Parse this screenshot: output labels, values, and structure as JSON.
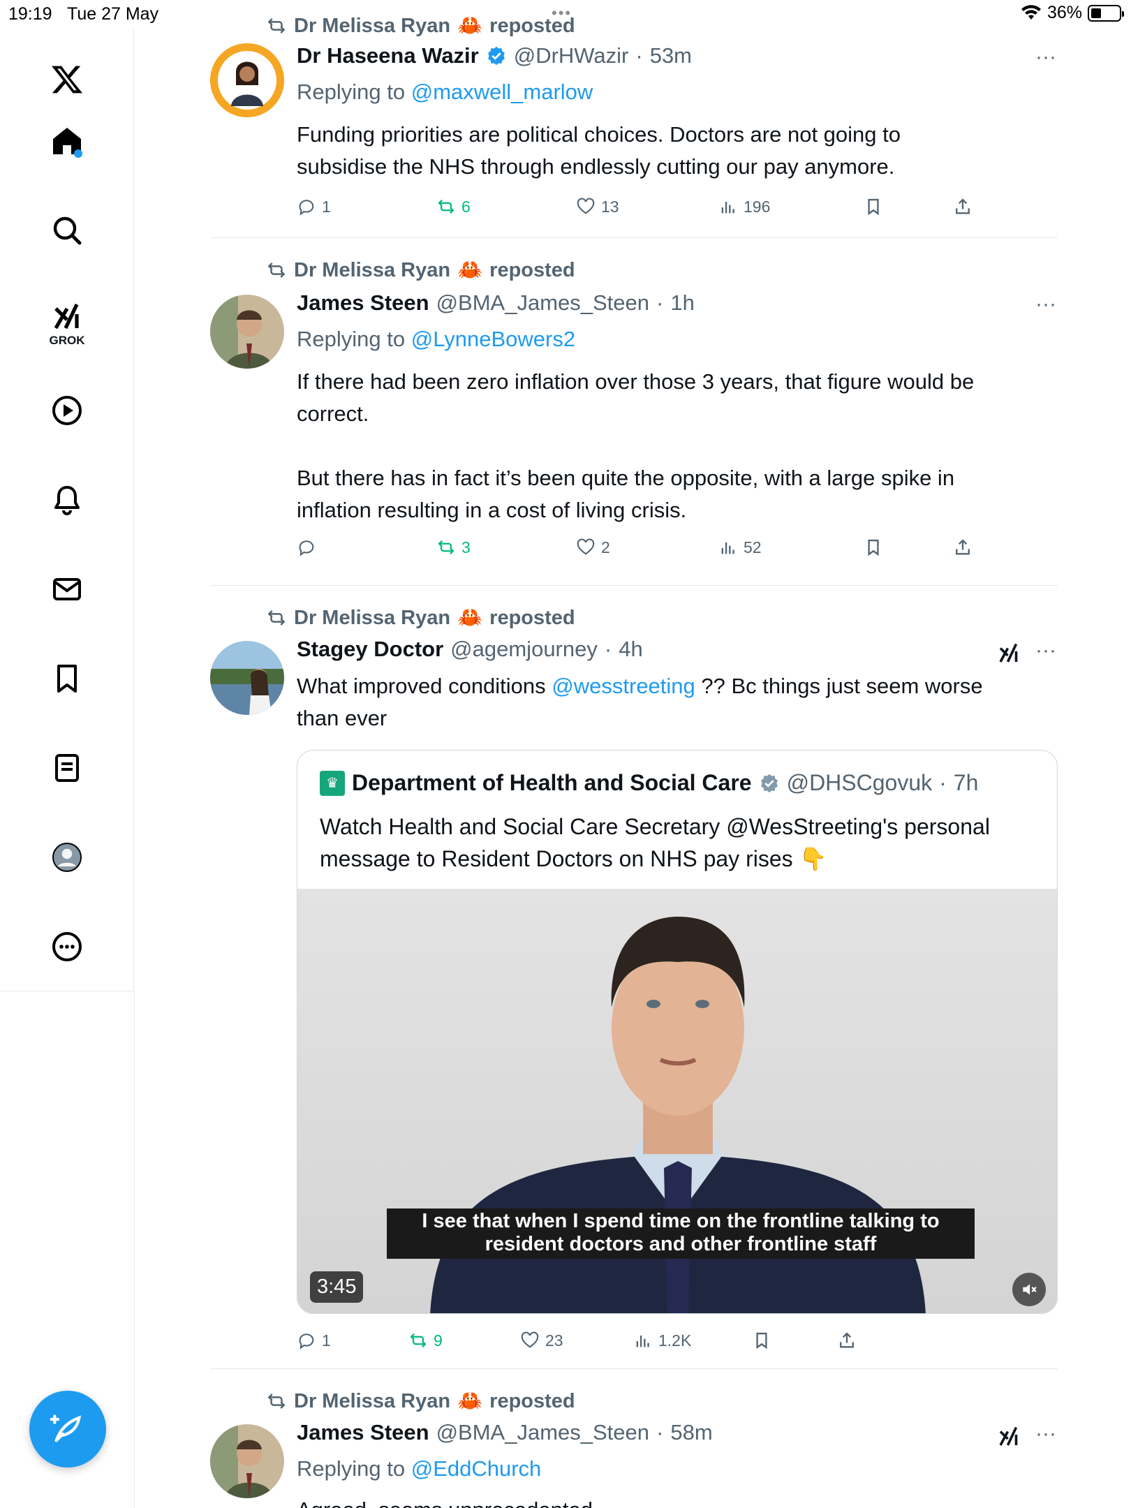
{
  "status_bar": {
    "time": "19:19",
    "date": "Tue 27 May",
    "more_dots": "•••",
    "battery": "36%"
  },
  "sidebar": {
    "items": [
      {
        "name": "x-logo"
      },
      {
        "name": "home"
      },
      {
        "name": "search"
      },
      {
        "name": "grok",
        "label": "GROK"
      },
      {
        "name": "video"
      },
      {
        "name": "notifications"
      },
      {
        "name": "messages"
      },
      {
        "name": "bookmarks"
      },
      {
        "name": "lists"
      },
      {
        "name": "profile"
      },
      {
        "name": "more"
      }
    ],
    "accent": "#1d9bf0"
  },
  "feed": {
    "posts": [
      {
        "repost_by": "Dr Melissa Ryan",
        "repost_label": "reposted",
        "author": "Dr Haseena Wazir",
        "verified": true,
        "handle": "@DrHWazir",
        "sep": "·",
        "time": "53m",
        "replying_prefix": "Replying to",
        "replying_to": "@maxwell_marlow",
        "text_lines": [
          "Funding priorities are political choices. Doctors are not going to",
          "subsidise the NHS through endlessly cutting our pay anymore."
        ],
        "replies": "1",
        "reposts": "6",
        "likes": "13",
        "views": "196"
      },
      {
        "repost_by": "Dr Melissa Ryan",
        "repost_label": "reposted",
        "author": "James Steen",
        "handle": "@BMA_James_Steen",
        "sep": "·",
        "time": "1h",
        "replying_prefix": "Replying to",
        "replying_to": "@LynneBowers2",
        "text_lines": [
          "If there had been zero inflation over those 3 years, that figure would be",
          "correct.",
          "",
          "But there has in fact it’s been quite the opposite, with a large spike in",
          "inflation resulting in a cost of living crisis."
        ],
        "replies": "",
        "reposts": "3",
        "likes": "2",
        "views": "52"
      },
      {
        "repost_by": "Dr Melissa Ryan",
        "repost_label": "reposted",
        "author": "Stagey Doctor",
        "handle": "@agemjourney",
        "sep": "·",
        "time": "4h",
        "text_prefix": "What improved conditions ",
        "text_mention": "@wesstreeting",
        "text_suffix": " ?? Bc things just seem worse",
        "text_line2": "than ever",
        "quote": {
          "author": "Department of Health and Social Care",
          "verified": true,
          "handle": "@DHSCgovuk",
          "sep": "·",
          "time": "7h",
          "text_line1": "Watch Health and Social Care Secretary @WesStreeting's personal",
          "text_line2": "message to Resident Doctors on NHS pay rises 👇",
          "subtitle_line1": "I see that when I spend time on the frontline talking to",
          "subtitle_line2": "resident doctors and other frontline staff",
          "duration": "3:45"
        },
        "replies": "1",
        "reposts": "9",
        "likes": "23",
        "views": "1.2K"
      },
      {
        "repost_by": "Dr Melissa Ryan",
        "repost_label": "reposted",
        "author": "James Steen",
        "handle": "@BMA_James_Steen",
        "sep": "·",
        "time": "58m",
        "replying_prefix": "Replying to",
        "replying_to": "@EddChurch",
        "text_partial": "Agreed, seems unprecedented"
      }
    ]
  }
}
